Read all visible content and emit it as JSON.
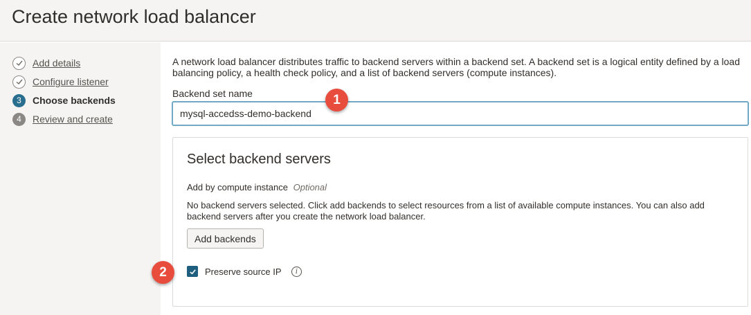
{
  "page": {
    "title": "Create network load balancer"
  },
  "steps": [
    {
      "marker": "",
      "label": "Add details",
      "state": "done"
    },
    {
      "marker": "",
      "label": "Configure listener",
      "state": "done"
    },
    {
      "marker": "3",
      "label": "Choose backends",
      "state": "current"
    },
    {
      "marker": "4",
      "label": "Review and create",
      "state": "future"
    }
  ],
  "main": {
    "intro": "A network load balancer distributes traffic to backend servers within a backend set. A backend set is a logical entity defined by a load balancing policy, a health check policy, and a list of backend servers (compute instances).",
    "backend_set": {
      "label": "Backend set name",
      "value": "mysql-accedss-demo-backend"
    },
    "servers_card": {
      "title": "Select backend servers",
      "add_label": "Add by compute instance",
      "optional": "Optional",
      "helper": "No backend servers selected. Click add backends to select resources from a list of available compute instances. You can also add backend servers after you create the network load balancer.",
      "add_button": "Add backends",
      "preserve_label": "Preserve source IP",
      "preserve_checked": true,
      "info": "i"
    }
  },
  "callouts": [
    "1",
    "2"
  ],
  "colors": {
    "callout": "#e84c3d",
    "accent": "#2a6e8f",
    "checkbox": "#1e5e7e"
  }
}
